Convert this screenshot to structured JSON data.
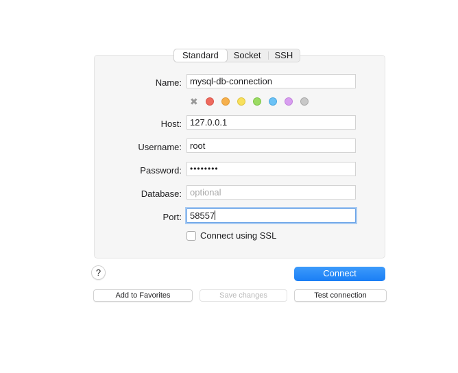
{
  "tabs": [
    "Standard",
    "Socket",
    "SSH"
  ],
  "active_tab": "Standard",
  "form": {
    "name_label": "Name:",
    "name_value": "mysql-db-connection",
    "host_label": "Host:",
    "host_value": "127.0.0.1",
    "username_label": "Username:",
    "username_value": "root",
    "password_label": "Password:",
    "password_value": "••••••••",
    "database_label": "Database:",
    "database_placeholder": "optional",
    "port_label": "Port:",
    "port_value": "58557",
    "ssl_label": "Connect using SSL",
    "ssl_checked": false
  },
  "color_swatches": [
    {
      "name": "none",
      "glyph": "✖"
    },
    {
      "name": "red",
      "color": "#ee6a5e",
      "border": "#d9564b"
    },
    {
      "name": "orange",
      "color": "#f6b04d",
      "border": "#e29a35"
    },
    {
      "name": "yellow",
      "color": "#f8e05c",
      "border": "#e0c640"
    },
    {
      "name": "green",
      "color": "#9bdb63",
      "border": "#80c44a"
    },
    {
      "name": "blue",
      "color": "#6cc2f6",
      "border": "#4ea9df"
    },
    {
      "name": "purple",
      "color": "#d89ef0",
      "border": "#c283dc"
    },
    {
      "name": "gray",
      "color": "#c8c8c8",
      "border": "#a9a9a9"
    }
  ],
  "buttons": {
    "help": "?",
    "connect": "Connect",
    "add_favorites": "Add to Favorites",
    "save_changes": "Save changes",
    "test_connection": "Test connection"
  },
  "colors": {
    "accent": "#1a7ef5",
    "focus_ring": "#a9cbf2"
  }
}
